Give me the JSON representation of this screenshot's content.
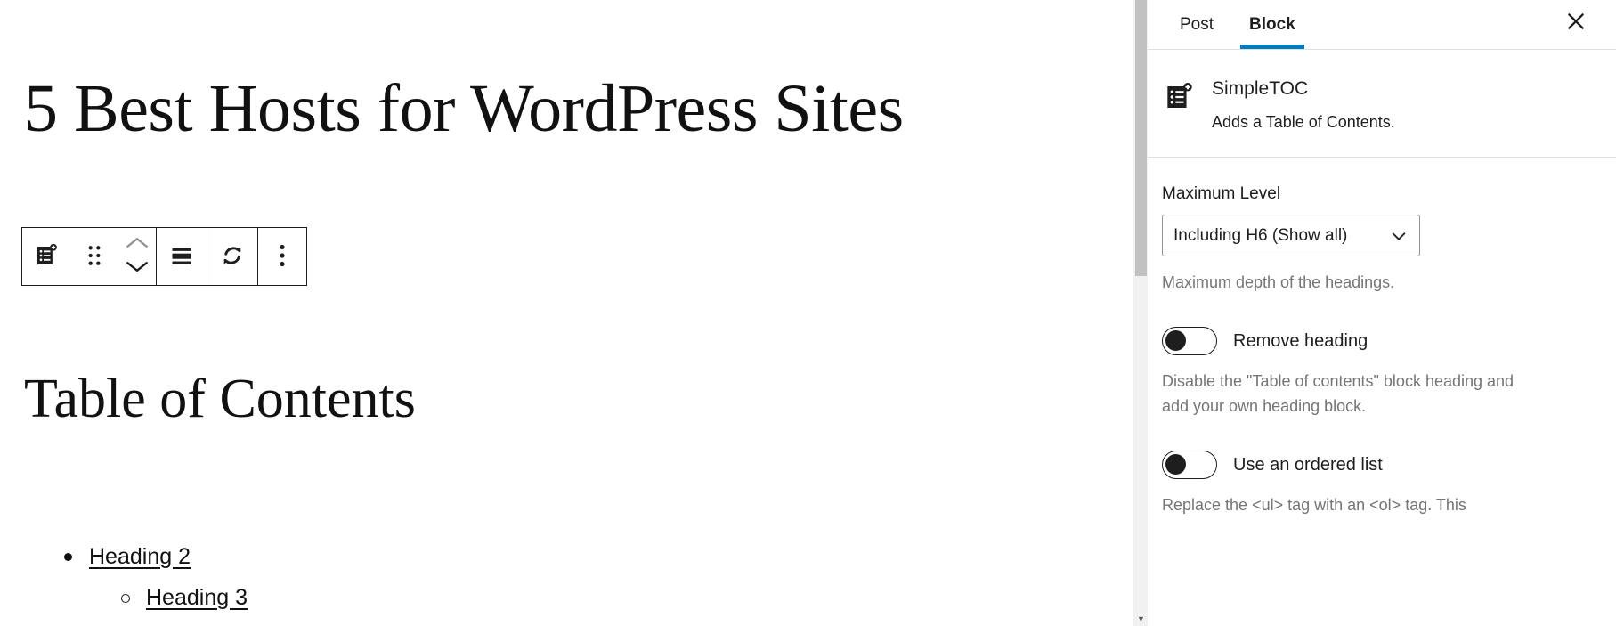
{
  "editor": {
    "post_title": "5 Best Hosts for WordPress Sites",
    "toc_block": {
      "heading": "Table of Contents",
      "items": [
        {
          "label": "Heading 2",
          "level": 2
        },
        {
          "label": "Heading 3",
          "level": 3
        }
      ]
    },
    "toolbar": {
      "block_type_label": "SimpleTOC",
      "drag_label": "Drag",
      "move_up_label": "Move up",
      "move_down_label": "Move down",
      "align_label": "Change alignment",
      "sync_label": "Refresh table of contents",
      "options_label": "Options"
    }
  },
  "sidebar": {
    "tabs": [
      {
        "id": "post",
        "label": "Post",
        "active": false
      },
      {
        "id": "block",
        "label": "Block",
        "active": true
      }
    ],
    "close_label": "Close settings",
    "accent_color": "#007cba",
    "block_card": {
      "icon": "list-view-icon",
      "title": "SimpleTOC",
      "description": "Adds a Table of Contents."
    },
    "settings": {
      "maximum_level": {
        "label": "Maximum Level",
        "value": "Including H6 (Show all)",
        "help": "Maximum depth of the headings."
      },
      "remove_heading": {
        "label": "Remove heading",
        "state": "off",
        "help": "Disable the \"Table of contents\" block heading and add your own heading block."
      },
      "use_ordered_list": {
        "label": "Use an ordered list",
        "state": "off",
        "help": "Replace the <ul> tag with an <ol> tag. This"
      }
    }
  }
}
